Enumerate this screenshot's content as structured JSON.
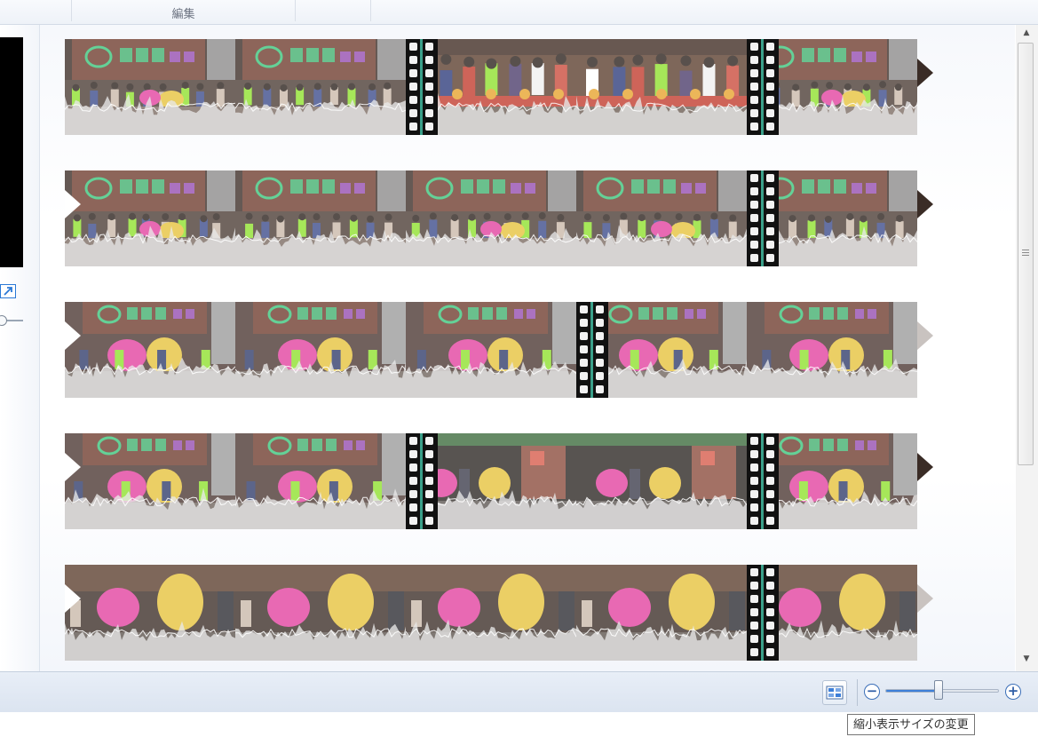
{
  "ribbon": {
    "group_label": "編集"
  },
  "statusbar": {
    "zoom_out_label": "−",
    "zoom_in_label": "+",
    "thumbnail_zoom_fraction": 0.47,
    "tooltip": "縮小表示サイズの変更"
  },
  "scrollbar": {
    "up_glyph": "▲",
    "down_glyph": "▼"
  },
  "storyboard": {
    "rows": [
      {
        "frames": [
          "sign",
          "sign",
          "stage",
          "stage",
          "sign"
        ],
        "boundaries": [
          2,
          4
        ],
        "arrow": "dark"
      },
      {
        "frames": [
          "sign",
          "sign",
          "sign",
          "sign",
          "sign"
        ],
        "boundaries": [
          4
        ],
        "arrow": "dark"
      },
      {
        "frames": [
          "lions",
          "lions",
          "lions",
          "lions",
          "lions"
        ],
        "boundaries": [
          3
        ],
        "arrow": "light"
      },
      {
        "frames": [
          "lions",
          "lions",
          "night",
          "night",
          "lions"
        ],
        "boundaries": [
          2,
          4
        ],
        "arrow": "dark"
      },
      {
        "frames": [
          "closeup",
          "closeup",
          "closeup",
          "closeup",
          "closeup"
        ],
        "boundaries": [
          4
        ],
        "arrow": "light"
      }
    ]
  },
  "colors": {
    "accent": "#3d7fd8",
    "sign_green": "#39c47a",
    "sign_purple": "#9b4fc7",
    "lion_pink": "#e23f9e",
    "lion_yellow": "#e6c23a",
    "shirt_green": "#8ee02b"
  },
  "icons": {
    "expand": "expand-icon",
    "thumbnail_size": "thumbnail-size-icon",
    "grip": "scroll-grip-icon"
  }
}
